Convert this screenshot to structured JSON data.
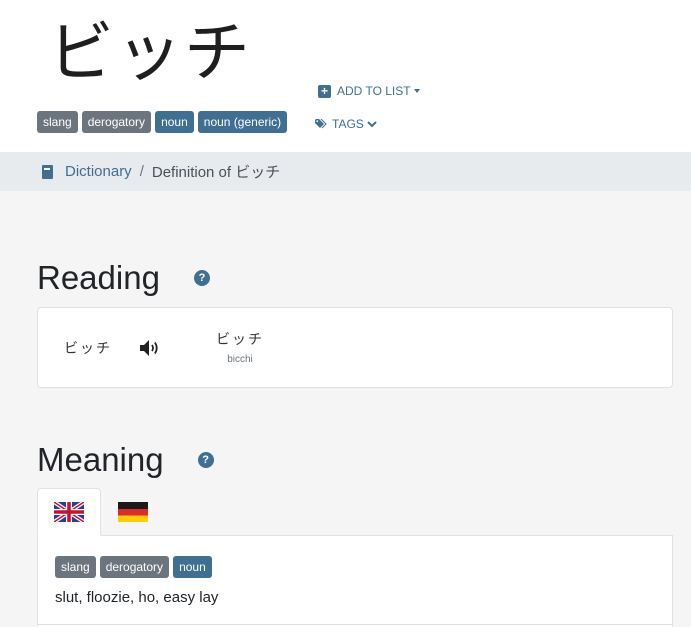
{
  "word": {
    "title": "ビッチ"
  },
  "actions": {
    "add_to_list": "ADD TO LIST",
    "tags": "TAGS"
  },
  "header_badges": [
    "slang",
    "derogatory",
    "noun",
    "noun (generic)"
  ],
  "breadcrumb": {
    "root": "Dictionary",
    "separator": "/",
    "current": "Definition of ビッチ"
  },
  "reading": {
    "heading": "Reading",
    "help": "?",
    "text": "ビッチ",
    "ruby_kana": "ビッチ",
    "ruby_romaji": "bicchi"
  },
  "meaning": {
    "heading": "Meaning",
    "help": "?",
    "tabs": [
      "english-flag-icon",
      "german-flag-icon"
    ],
    "badges": [
      "slang",
      "derogatory",
      "noun"
    ],
    "definition": "slut, floozie, ho, easy lay"
  },
  "colors": {
    "accent": "#3f6f93",
    "badge_gray": "#6c757d"
  }
}
